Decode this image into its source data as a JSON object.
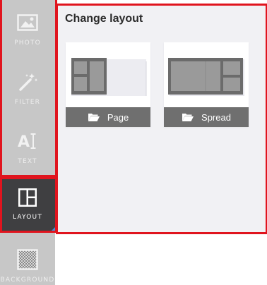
{
  "sidebar": {
    "items": [
      {
        "key": "photo",
        "label": "PHOTO",
        "icon": "photo-icon"
      },
      {
        "key": "filter",
        "label": "FILTER",
        "icon": "magic-wand-icon"
      },
      {
        "key": "text",
        "label": "TEXT",
        "icon": "text-cursor-icon"
      },
      {
        "key": "layout",
        "label": "LAYOUT",
        "icon": "layout-grid-icon",
        "active": true
      },
      {
        "key": "background",
        "label": "BACKGROUND",
        "icon": "checker-pattern-icon"
      }
    ],
    "active_color": "#3f3f41",
    "background_color": "#c7c7c7"
  },
  "panel": {
    "title": "Change layout",
    "cards": [
      {
        "key": "page",
        "label": "Page",
        "icon": "folder-open-icon"
      },
      {
        "key": "spread",
        "label": "Spread",
        "icon": "folder-open-icon"
      }
    ]
  },
  "colors": {
    "annotation_outline": "#e0141e",
    "card_bar": "#6f6f6f",
    "panel_bg": "#f1f1f4"
  }
}
